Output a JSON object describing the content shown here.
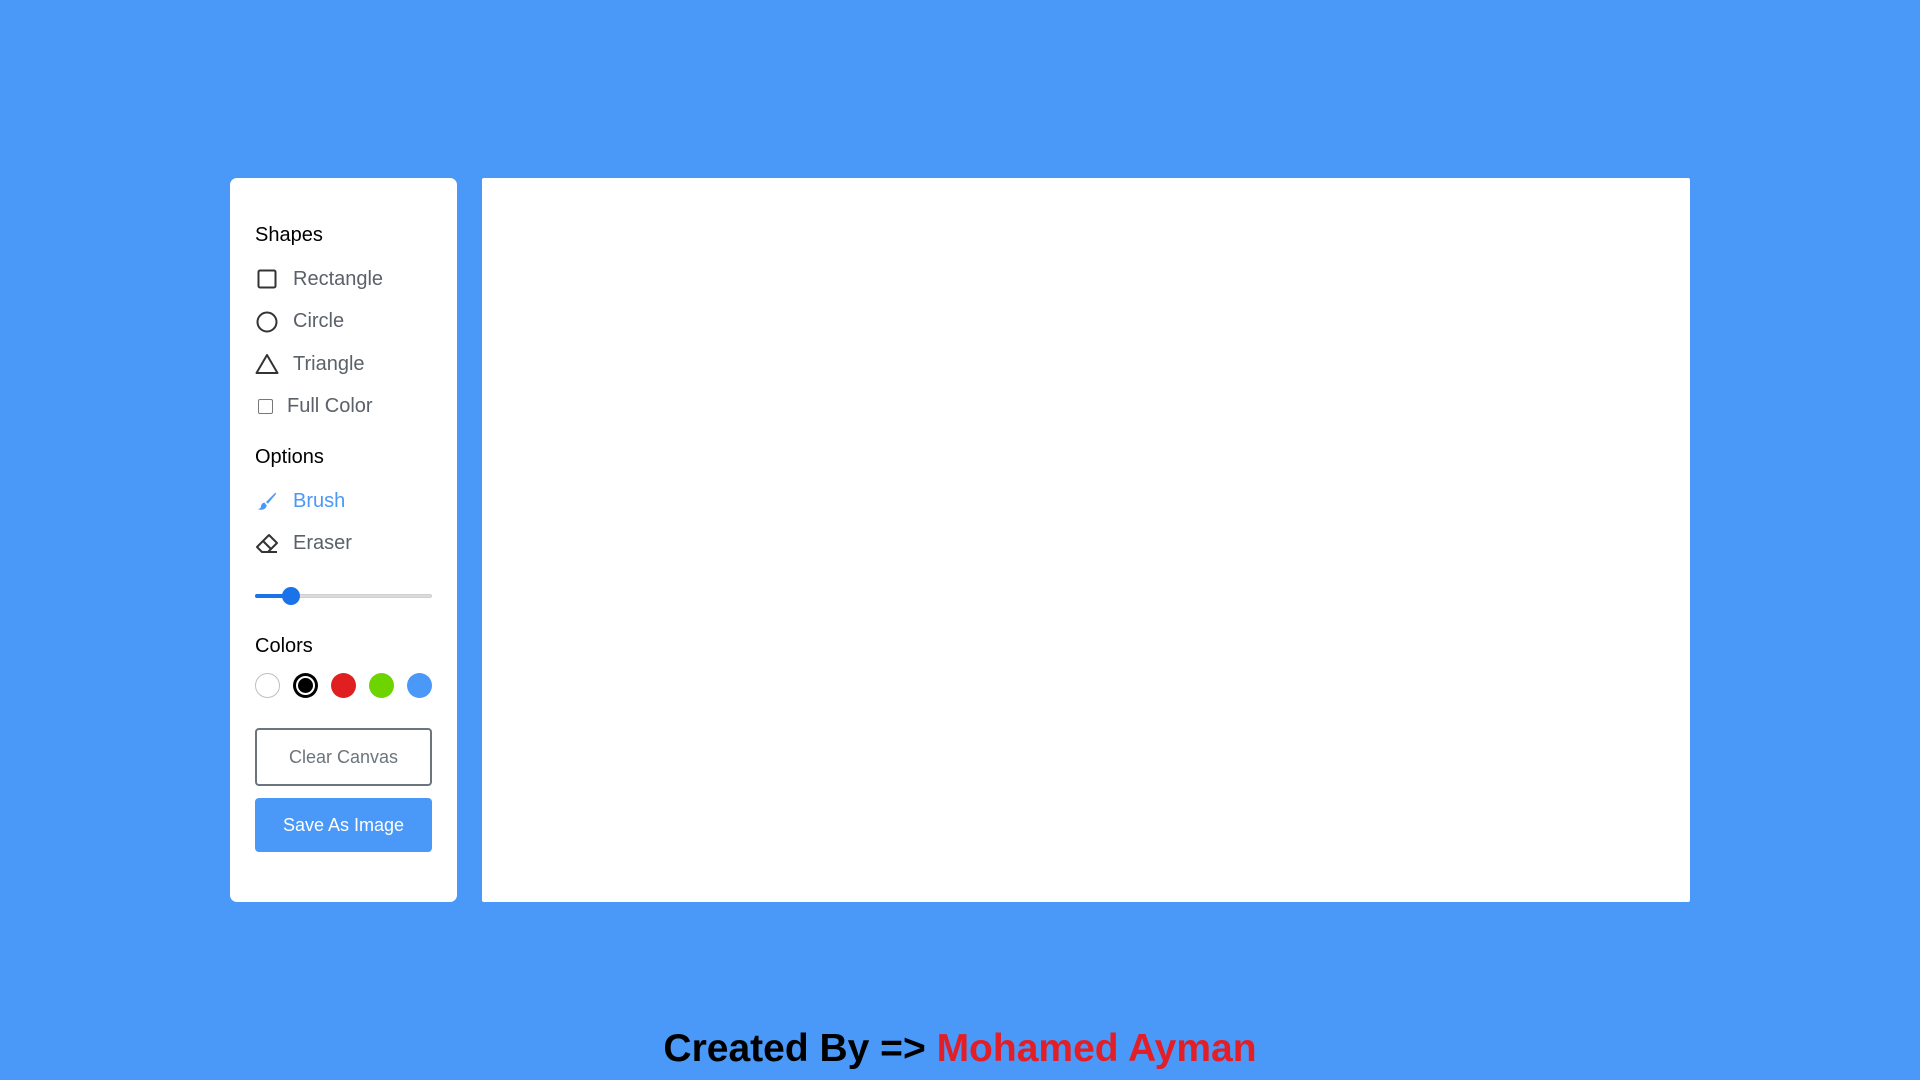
{
  "shapes": {
    "title": "Shapes",
    "items": [
      {
        "label": "Rectangle",
        "icon": "rectangle-outline-icon"
      },
      {
        "label": "Circle",
        "icon": "circle-outline-icon"
      },
      {
        "label": "Triangle",
        "icon": "triangle-outline-icon"
      }
    ],
    "fill_label": "Full Color",
    "fill_checked": false
  },
  "options": {
    "title": "Options",
    "items": [
      {
        "label": "Brush",
        "icon": "brush-icon",
        "active": true
      },
      {
        "label": "Eraser",
        "icon": "eraser-icon",
        "active": false
      }
    ],
    "brush_size": {
      "min": 1,
      "max": 30,
      "value": 5
    }
  },
  "colors": {
    "title": "Colors",
    "swatches": [
      "#ffffff",
      "#000000",
      "#e02020",
      "#6dd400",
      "#4a98f7"
    ],
    "selected": "#000000"
  },
  "buttons": {
    "clear": "Clear Canvas",
    "save": "Save As Image"
  },
  "footer": {
    "prefix": "Created By => ",
    "author": "Mohamed Ayman"
  },
  "theme": {
    "background": "#4a98f7",
    "accent": "#4a98f7",
    "author_color": "#e41e26"
  }
}
